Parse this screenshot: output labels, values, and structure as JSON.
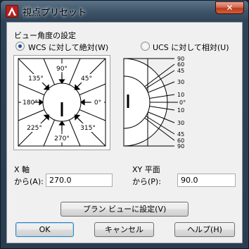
{
  "window": {
    "title": "視点プリセット",
    "close_glyph": "✕"
  },
  "section_title": "ビュー角度の設定",
  "radios": {
    "wcs_label": "WCS に対して絶対(W)",
    "ucs_label": "UCS に対して相対(U)"
  },
  "dial": {
    "labels": [
      "90°",
      "45°",
      "0°",
      "315°",
      "270°",
      "225°",
      "180°",
      "135°"
    ]
  },
  "elevation": {
    "labels": [
      "90",
      "60",
      "45",
      "30",
      "10",
      "0°",
      "10",
      "30",
      "45",
      "60",
      "90"
    ]
  },
  "x_axis": {
    "title": "X 軸",
    "from_label": "から(A):",
    "value": "270.0"
  },
  "xy_plane": {
    "title": "XY 平面",
    "from_label": "から(P):",
    "value": "90.0"
  },
  "buttons": {
    "plan_view": "プラン ビューに設定(V)",
    "ok": "OK",
    "cancel": "キャンセル",
    "help": "ヘルプ(H)"
  },
  "colors": {
    "accent": "#1d4b9c",
    "close": "#c8462a"
  }
}
